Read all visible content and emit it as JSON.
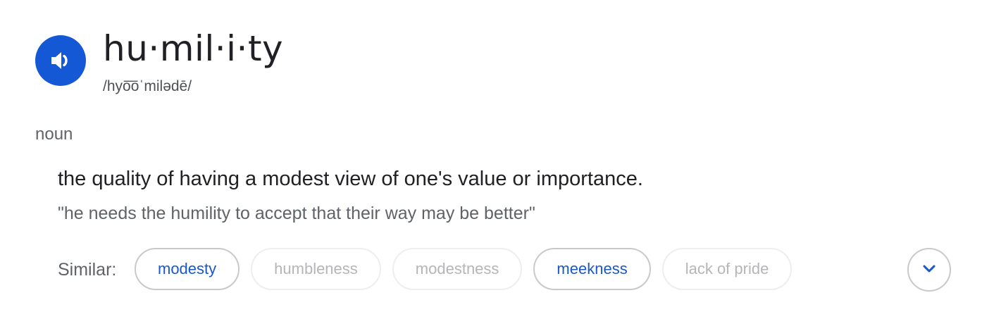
{
  "entry": {
    "word": "hu·mil·i·ty",
    "phonetic": "/hyo͞oˈmilədē/",
    "part_of_speech": "noun",
    "definition": "the quality of having a modest view of one's value or importance.",
    "example": "\"he needs the humility to accept that their way may be better\""
  },
  "similar": {
    "label": "Similar:",
    "chips": [
      {
        "text": "modesty",
        "linked": true
      },
      {
        "text": "humbleness",
        "linked": false
      },
      {
        "text": "modestness",
        "linked": false
      },
      {
        "text": "meekness",
        "linked": true
      },
      {
        "text": "lack of pride",
        "linked": false
      }
    ]
  },
  "icons": {
    "speak": "speaker-icon",
    "expand": "chevron-down-icon"
  },
  "colors": {
    "accent": "#1558d6",
    "link_text": "#1a57c7",
    "muted_text": "#b3b5b8"
  }
}
